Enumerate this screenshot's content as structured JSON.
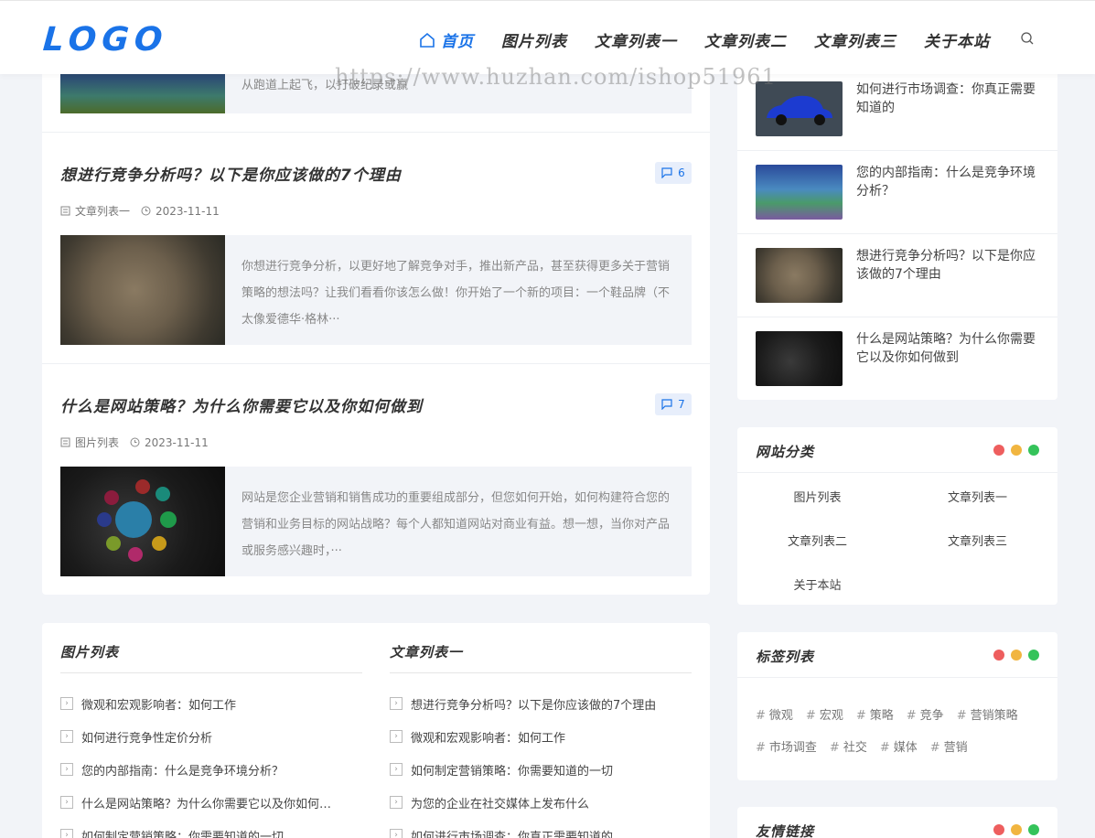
{
  "header": {
    "logo": "LOGO",
    "nav": [
      {
        "label": "首页",
        "active": true
      },
      {
        "label": "图片列表",
        "active": false
      },
      {
        "label": "文章列表一",
        "active": false
      },
      {
        "label": "文章列表二",
        "active": false
      },
      {
        "label": "文章列表三",
        "active": false
      },
      {
        "label": "关于本站",
        "active": false
      }
    ]
  },
  "watermark": "https://www.huzhan.com/ishop51961",
  "main": {
    "top_excerpt": "从跑道上起飞，以打破纪录或赢",
    "articles": [
      {
        "title": "想进行竞争分析吗？以下是你应该做的7个理由",
        "comments": "6",
        "category": "文章列表一",
        "date": "2023-11-11",
        "excerpt": "你想进行竞争分析，以更好地了解竞争对手，推出新产品，甚至获得更多关于营销策略的想法吗？让我们看看你该怎么做！你开始了一个新的项目：一个鞋品牌（不太像爱德华·格林···"
      },
      {
        "title": "什么是网站策略？为什么你需要它以及你如何做到",
        "comments": "7",
        "category": "图片列表",
        "date": "2023-11-11",
        "excerpt": "网站是您企业营销和销售成功的重要组成部分，但您如何开始，如何构建符合您的营销和业务目标的网站战略？每个人都知道网站对商业有益。想一想，当你对产品或服务感兴趣时，···"
      }
    ]
  },
  "lower": {
    "col1": {
      "title": "图片列表",
      "items": [
        "微观和宏观影响者：如何工作",
        "如何进行竞争性定价分析",
        "您的内部指南：什么是竞争环境分析？",
        "什么是网站策略？为什么你需要它以及你如何…",
        "如何制定营销策略：你需要知道的一切"
      ]
    },
    "col2": {
      "title": "文章列表一",
      "items": [
        "想进行竞争分析吗？以下是你应该做的7个理由",
        "微观和宏观影响者：如何工作",
        "如何制定营销策略：你需要知道的一切",
        "为您的企业在社交媒体上发布什么",
        "如何进行市场调查：你真正需要知道的"
      ]
    }
  },
  "sidebar": {
    "recent": [
      {
        "title": "如何进行市场调查：你真正需要知道的"
      },
      {
        "title": "您的内部指南：什么是竞争环境分析？"
      },
      {
        "title": "想进行竞争分析吗？以下是你应该做的7个理由"
      },
      {
        "title": "什么是网站策略？为什么你需要它以及你如何做到"
      }
    ],
    "categories": {
      "title": "网站分类",
      "items": [
        "图片列表",
        "文章列表一",
        "文章列表二",
        "文章列表三",
        "关于本站"
      ]
    },
    "tags": {
      "title": "标签列表",
      "row1": [
        "微观",
        "宏观",
        "策略",
        "竞争",
        "营销策略"
      ],
      "row2": [
        "市场调查",
        "社交",
        "媒体",
        "营销"
      ]
    },
    "friends": {
      "title": "友情链接"
    },
    "dot_colors": [
      "#ee5e5e",
      "#f1b540",
      "#35c35a"
    ]
  },
  "colors": {
    "accent": "#1a73e8",
    "background": "#f2f4f8"
  }
}
